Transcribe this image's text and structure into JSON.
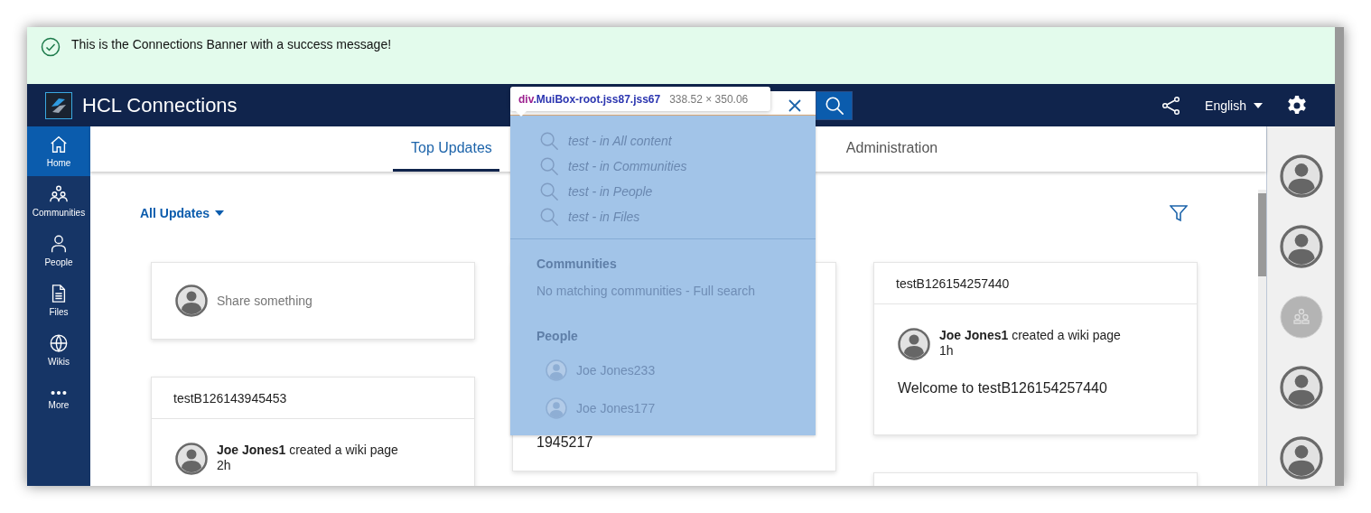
{
  "banner": {
    "message": "This is the Connections Banner with a success message!"
  },
  "header": {
    "title": "HCL Connections",
    "language": "English"
  },
  "inspector": {
    "tag": "div",
    "classes": ".MuiBox-root.jss87.jss67",
    "size": "338.52 × 350.06"
  },
  "search_suggestions": [
    "test - in All content",
    "test - in Communities",
    "test - in People",
    "test - in Files"
  ],
  "communities": {
    "heading": "Communities",
    "message": "No matching communities - Full search"
  },
  "people": {
    "heading": "People",
    "items": [
      "Joe Jones233",
      "Joe Jones177"
    ]
  },
  "nav": [
    {
      "label": "Home",
      "kind": "home",
      "selected": true
    },
    {
      "label": "Communities",
      "kind": "communities",
      "selected": false
    },
    {
      "label": "People",
      "kind": "people",
      "selected": false
    },
    {
      "label": "Files",
      "kind": "files",
      "selected": false
    },
    {
      "label": "Wikis",
      "kind": "wikis",
      "selected": false
    },
    {
      "label": "More",
      "kind": "more",
      "selected": false
    }
  ],
  "tabs": [
    {
      "label": "Top Updates",
      "selected": true
    },
    {
      "label": "Administration",
      "selected": false
    }
  ],
  "filter": {
    "label": "All Updates"
  },
  "columns": [
    [
      {
        "kind": "share",
        "placeholder": "Share something"
      },
      {
        "kind": "wiki",
        "title": "testB126143945453",
        "author": "Joe Jones1",
        "action": "created a wiki page",
        "time": "2h"
      }
    ],
    [
      {
        "kind": "partial",
        "body": "1945217"
      }
    ],
    [
      {
        "kind": "wiki",
        "title": "testB126154257440",
        "author": "Joe Jones1",
        "action": "created a wiki page",
        "time": "1h",
        "body": "Welcome to testB126154257440"
      },
      {
        "kind": "stub"
      }
    ]
  ],
  "rail": [
    {
      "kind": "person"
    },
    {
      "kind": "person"
    },
    {
      "kind": "community"
    },
    {
      "kind": "person"
    },
    {
      "kind": "person"
    }
  ]
}
